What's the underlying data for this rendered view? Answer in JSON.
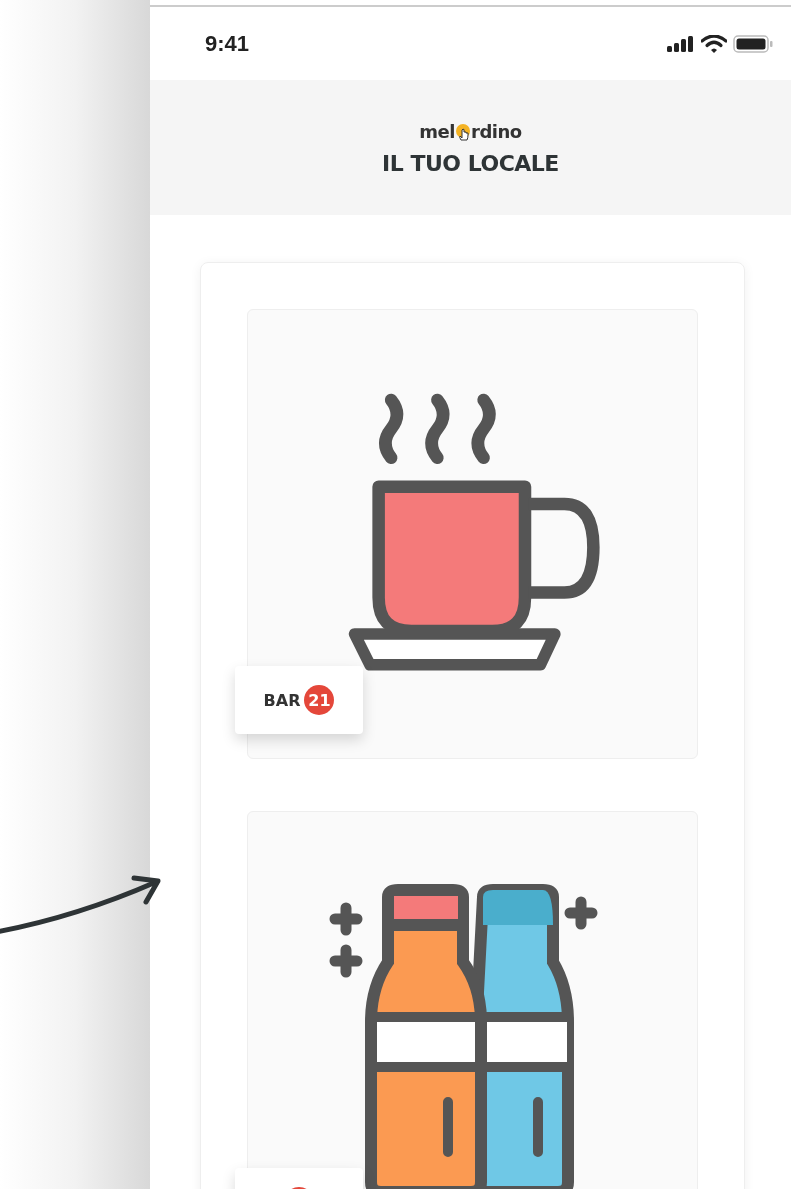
{
  "status_bar": {
    "time": "9:41"
  },
  "header": {
    "logo_left": "mel",
    "logo_right": "rdino",
    "title": "IL TUO LOCALE"
  },
  "categories": [
    {
      "kind": "coffee",
      "label": "BAR",
      "count": "21"
    },
    {
      "kind": "bottles"
    }
  ]
}
